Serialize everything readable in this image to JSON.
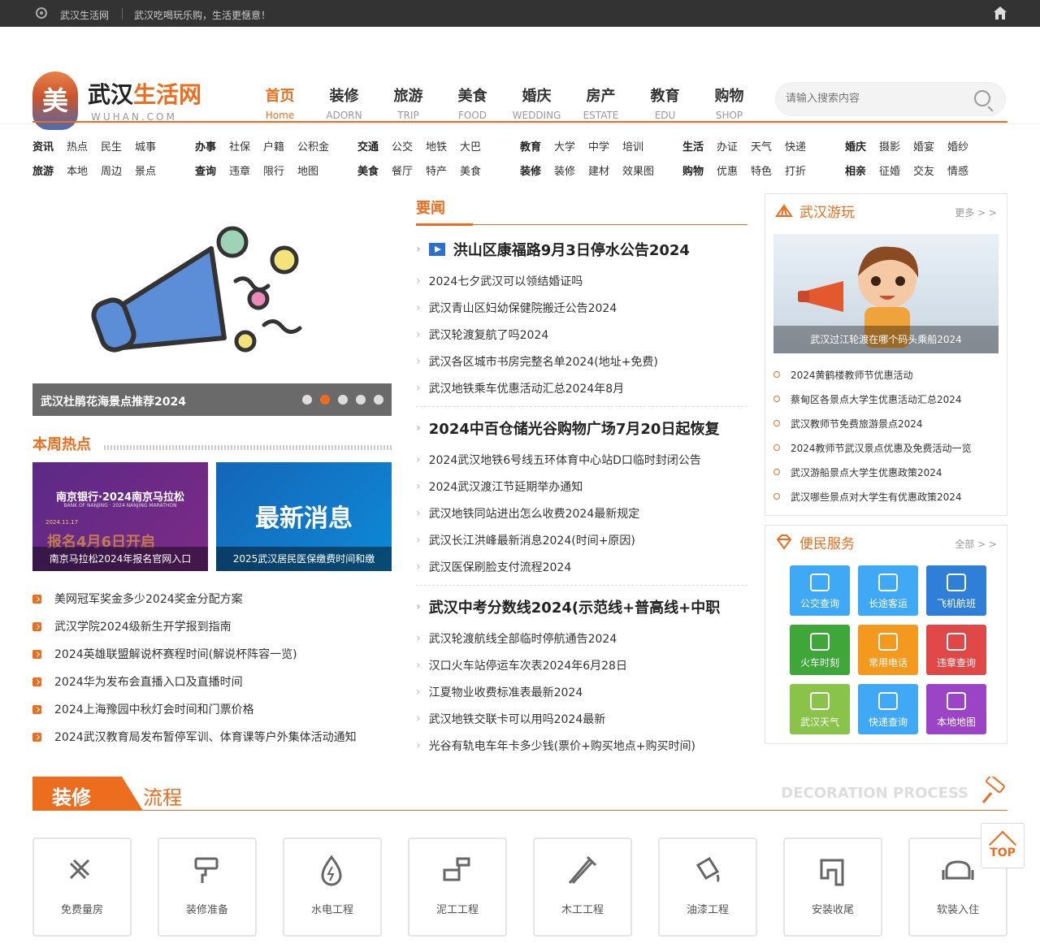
{
  "topbar": {
    "site": "武汉生活网",
    "slogan": "武汉吃喝玩乐购，生活更惬意！"
  },
  "logo": {
    "char": "美",
    "title_a": "武汉",
    "title_b": "生活网",
    "sub": "WUHAN.COM"
  },
  "nav": [
    {
      "cn": "首页",
      "en": "Home"
    },
    {
      "cn": "装修",
      "en": "ADORN"
    },
    {
      "cn": "旅游",
      "en": "TRIP"
    },
    {
      "cn": "美食",
      "en": "FOOD"
    },
    {
      "cn": "婚庆",
      "en": "WEDDING"
    },
    {
      "cn": "房产",
      "en": "ESTATE"
    },
    {
      "cn": "教育",
      "en": "EDU"
    },
    {
      "cn": "购物",
      "en": "SHOP"
    }
  ],
  "search": {
    "placeholder": "请输入搜索内容"
  },
  "categories": {
    "row1": [
      [
        "资讯",
        "热点",
        "民生",
        "城事"
      ],
      [
        "办事",
        "社保",
        "户籍",
        "公积金"
      ],
      [
        "交通",
        "公交",
        "地铁",
        "大巴"
      ],
      [
        "教育",
        "大学",
        "中学",
        "培训"
      ],
      [
        "生活",
        "办证",
        "天气",
        "快递"
      ],
      [
        "婚庆",
        "摄影",
        "婚宴",
        "婚纱"
      ]
    ],
    "row2": [
      [
        "旅游",
        "本地",
        "周边",
        "景点"
      ],
      [
        "查询",
        "违章",
        "限行",
        "地图"
      ],
      [
        "美食",
        "餐厅",
        "特产",
        "美食"
      ],
      [
        "装修",
        "装修",
        "建材",
        "效果图"
      ],
      [
        "购物",
        "优惠",
        "特色",
        "打折"
      ],
      [
        "相亲",
        "征婚",
        "交友",
        "情感"
      ]
    ]
  },
  "slider": {
    "caption": "武汉杜鹃花海景点推荐2024"
  },
  "hot": {
    "title": "本周热点",
    "thumbs": [
      {
        "caption": "南京马拉松2024年报名官网入口",
        "big": "南京银行·2024南京马拉松",
        "small": "BANK OF NANJING · 2024 NANJING MARATHON",
        "date": "2024.11.17",
        "overlay": "报名4月6日开启"
      },
      {
        "caption": "2025武汉居民医保缴费时间和缴",
        "big": "最新消息"
      }
    ],
    "list": [
      "美网冠军奖金多少2024奖金分配方案",
      "武汉学院2024级新生开学报到指南",
      "2024英雄联盟解说杯赛程时间(解说杯阵容一览)",
      "2024华为发布会直播入口及直播时间",
      "2024上海豫园中秋灯会时间和门票价格",
      "2024武汉教育局发布暂停军训、体育课等户外集体活动通知"
    ]
  },
  "news": {
    "title": "要闻",
    "groups": [
      {
        "headline": "洪山区康福路9月3日停水公告2024",
        "items": [
          "2024七夕武汉可以领结婚证吗",
          "武汉青山区妇幼保健院搬迁公告2024",
          "武汉轮渡复航了吗2024",
          "武汉各区城市书房完整名单2024(地址+免费)",
          "武汉地铁乘车优惠活动汇总2024年8月"
        ]
      },
      {
        "headline": "2024中百仓储光谷购物广场7月20日起恢复",
        "items": [
          "2024武汉地铁6号线五环体育中心站D口临时封闭公告",
          "2024武汉渡江节延期举办通知",
          "武汉地铁同站进出怎么收费2024最新规定",
          "武汉长江洪峰最新消息2024(时间+原因)",
          "武汉医保刷脸支付流程2024"
        ]
      },
      {
        "headline": "武汉中考分数线2024(示范线+普高线+中职",
        "items": [
          "武汉轮渡航线全部临时停航通告2024",
          "汉口火车站停运车次表2024年6月28日",
          "江夏物业收费标准表最新2024",
          "武汉地铁交联卡可以用吗2024最新",
          "光谷有轨电车年卡多少钱(票价+购买地点+购买时间)"
        ]
      }
    ]
  },
  "play": {
    "title": "武汉游玩",
    "more": "更多 > >",
    "caption": "武汉过江轮渡在哪个码头乘船2024",
    "items": [
      "2024黄鹤楼教师节优惠活动",
      "蔡甸区各景点大学生优惠活动汇总2024",
      "武汉教师节免费旅游景点2024",
      "2024教师节武汉景点优惠及免费活动一览",
      "武汉游船景点大学生优惠政策2024",
      "武汉哪些景点对大学生有优惠政策2024"
    ]
  },
  "service": {
    "title": "便民服务",
    "more": "全部 > >",
    "items": [
      {
        "label": "公交查询",
        "color": "#3fa9f5"
      },
      {
        "label": "长途客运",
        "color": "#3fa9f5"
      },
      {
        "label": "飞机航班",
        "color": "#2f7fd8"
      },
      {
        "label": "火车时刻",
        "color": "#3fa73a"
      },
      {
        "label": "常用电话",
        "color": "#f39a1e"
      },
      {
        "label": "违章查询",
        "color": "#e04848"
      },
      {
        "label": "武汉天气",
        "color": "#8ac34a"
      },
      {
        "label": "快递查询",
        "color": "#3fa9f5"
      },
      {
        "label": "本地地图",
        "color": "#9b45c6"
      }
    ]
  },
  "deco": {
    "tag": "装修",
    "title": "流程",
    "en": "DECORATION PROCESS",
    "items": [
      "免费量房",
      "装修准备",
      "水电工程",
      "泥工工程",
      "木工工程",
      "油漆工程",
      "安装收尾",
      "软装入住"
    ]
  },
  "totop": "TOP"
}
